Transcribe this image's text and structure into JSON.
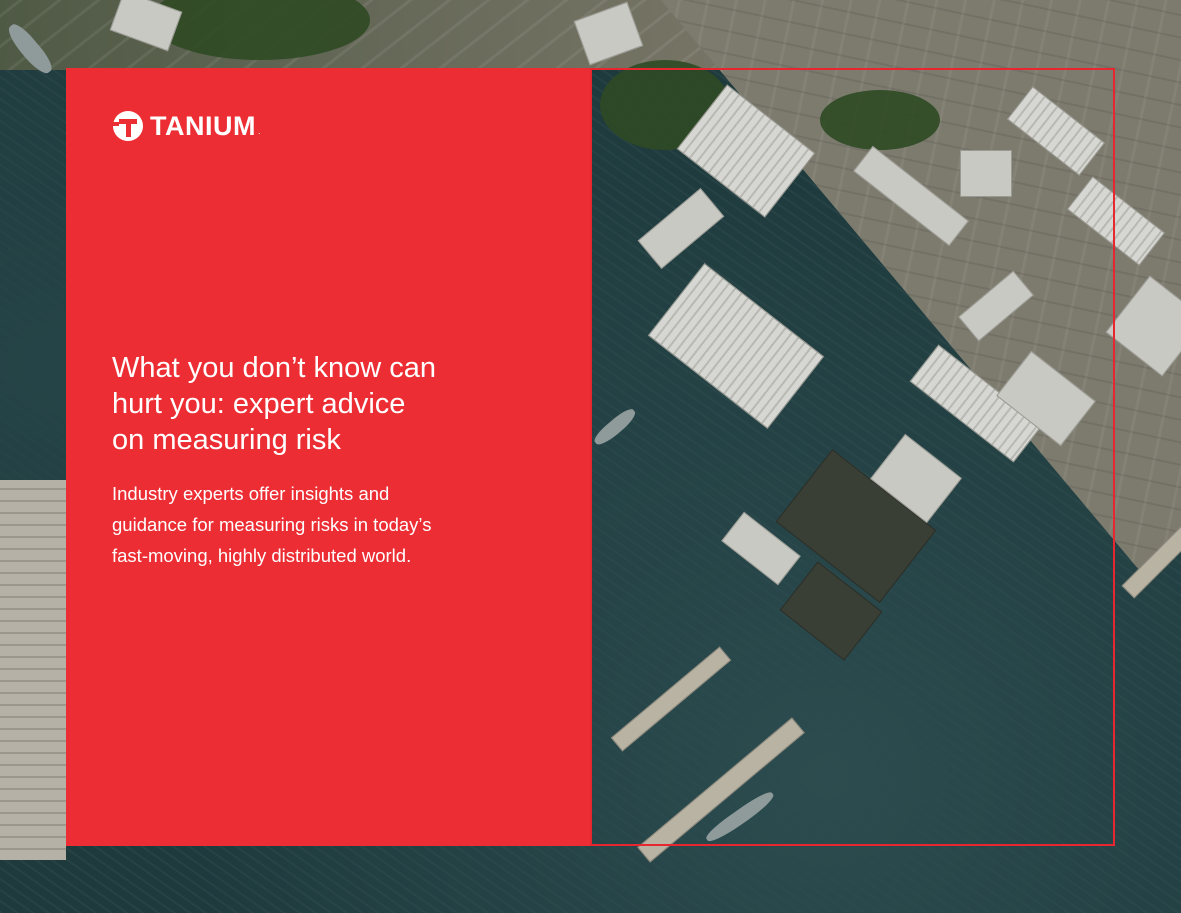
{
  "brand": {
    "logo_text": "TANIUM",
    "logo_mark_icon": "tanium-t-mark-icon",
    "trademark": "."
  },
  "hero": {
    "headline": "What you don’t know can\nhurt you: expert advice\non measuring risk",
    "subheadline": "Industry experts offer insights and\nguidance for measuring risks in today’s\nfast-moving, highly distributed world."
  },
  "background": {
    "image": "aerial-shipyard-photo"
  },
  "colors": {
    "brand_red": "#ec2d33",
    "frame_red": "#e8262f",
    "text": "#ffffff"
  }
}
